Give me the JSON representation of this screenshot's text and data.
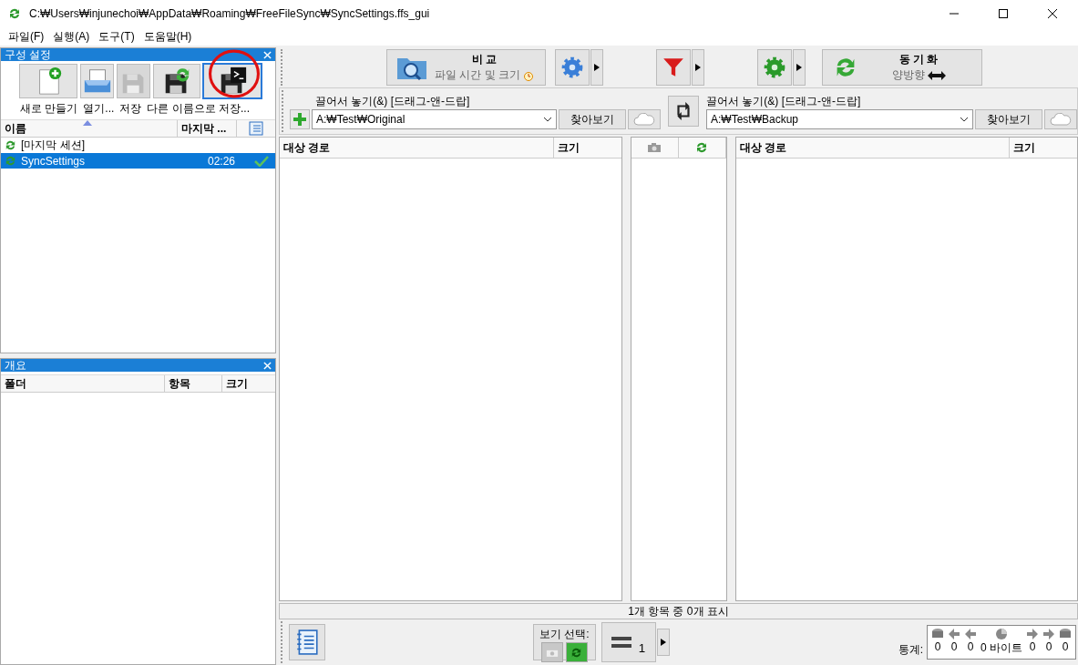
{
  "window": {
    "title": "C:₩Users₩injunechoi₩AppData₩Roaming₩FreeFileSync₩SyncSettings.ffs_gui"
  },
  "menu": [
    "파일(F)",
    "실행(A)",
    "도구(T)",
    "도움말(H)"
  ],
  "config_panel": {
    "title": "구성 설정",
    "tools": [
      {
        "kind": "new",
        "label": "새로 만들기",
        "disabled": false
      },
      {
        "kind": "open",
        "label": "열기...",
        "disabled": false
      },
      {
        "kind": "save",
        "label": "저장",
        "disabled": true
      },
      {
        "kind": "save_as",
        "label": "다른 이름으로 저장...",
        "disabled": false
      },
      {
        "kind": "save_batch",
        "disabled": false
      }
    ],
    "columns": [
      "이름",
      "마지막 ..."
    ],
    "sessions": [
      {
        "name": "[마지막 세션]",
        "selected": false,
        "ok": false
      },
      {
        "name": "SyncSettings",
        "time": "02:26",
        "selected": true,
        "ok": true
      }
    ]
  },
  "overview_panel": {
    "title": "개요",
    "columns": [
      "폴더",
      "항목",
      "크기"
    ]
  },
  "toolbar": {
    "compare": {
      "title": "비 교",
      "subtitle": "파일 시간 및 크기"
    },
    "sync": {
      "title": "동 기 화",
      "subtitle": "양방향"
    }
  },
  "folder_pairs": [
    {
      "label": "끌어서 놓기(&) [드래그-앤-드랍]",
      "path": "A:₩Test₩Original",
      "browse": "찾아보기"
    },
    {
      "label": "끌어서 놓기(&) [드래그-앤-드랍]",
      "path": "A:₩Test₩Backup",
      "browse": "찾아보기"
    }
  ],
  "grids": [
    {
      "columns": [
        "대상 경로",
        "크기"
      ]
    },
    {
      "columns": [
        "대상 경로",
        "크기"
      ]
    }
  ],
  "status": "1개 항목 중 0개 표시",
  "bottom": {
    "view_label": "보기 선택:",
    "count": "1",
    "stats_label": "통계:",
    "stats": [
      "0",
      "0",
      "0",
      "0 바이트",
      "0",
      "0",
      "0"
    ]
  }
}
